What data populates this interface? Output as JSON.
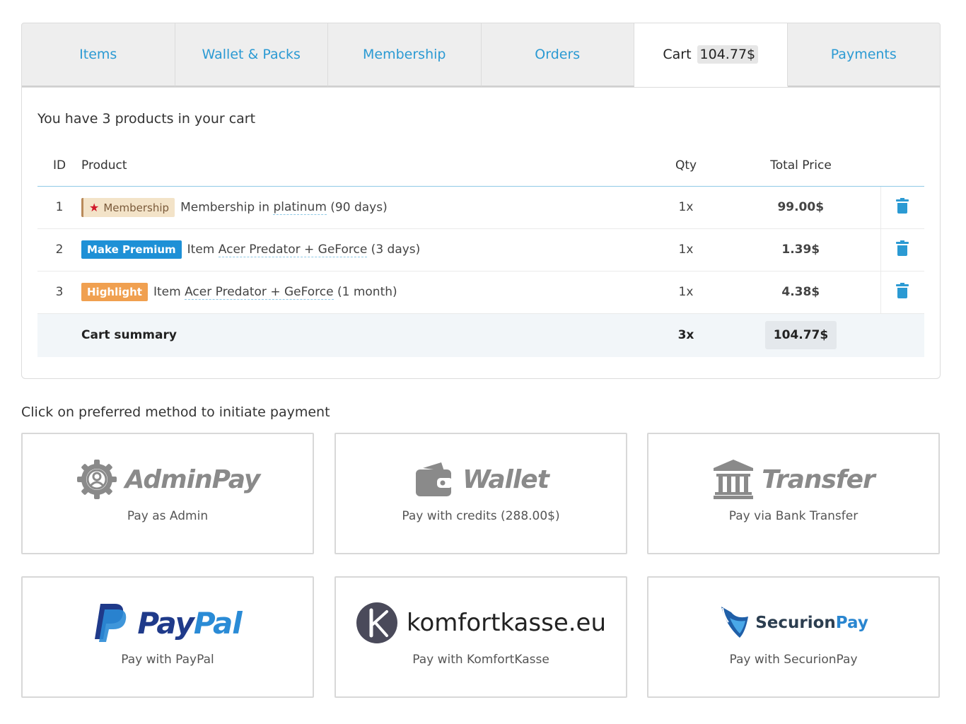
{
  "tabs": [
    {
      "label": "Items"
    },
    {
      "label": "Wallet & Packs"
    },
    {
      "label": "Membership"
    },
    {
      "label": "Orders"
    },
    {
      "label": "Cart",
      "amount": "104.77$",
      "active": true
    },
    {
      "label": "Payments"
    }
  ],
  "cart": {
    "heading": "You have 3 products in your cart",
    "columns": {
      "id": "ID",
      "product": "Product",
      "qty": "Qty",
      "total": "Total Price"
    },
    "rows": [
      {
        "id": "1",
        "badge": "Membership",
        "badge_type": "membership",
        "name_prefix": "Membership in ",
        "name_link": "platinum",
        "name_suffix": " (90 days)",
        "qty": "1x",
        "price": "99.00$"
      },
      {
        "id": "2",
        "badge": "Make Premium",
        "badge_type": "premium",
        "name_prefix": "Item ",
        "name_link": "Acer Predator + GeForce",
        "name_suffix": " (3 days)",
        "qty": "1x",
        "price": "1.39$"
      },
      {
        "id": "3",
        "badge": "Highlight",
        "badge_type": "highlight",
        "name_prefix": "Item ",
        "name_link": "Acer Predator + GeForce",
        "name_suffix": " (1 month)",
        "qty": "1x",
        "price": "4.38$"
      }
    ],
    "summary": {
      "label": "Cart summary",
      "qty": "3x",
      "total": "104.77$"
    }
  },
  "payment": {
    "heading": "Click on preferred method to initiate payment",
    "methods": [
      {
        "logo_text": "AdminPay",
        "icon": "gear-user-icon",
        "caption": "Pay as Admin"
      },
      {
        "logo_text": "Wallet",
        "icon": "wallet-icon",
        "caption": "Pay with credits (288.00$)"
      },
      {
        "logo_text": "Transfer",
        "icon": "bank-icon",
        "caption": "Pay via Bank Transfer"
      },
      {
        "logo_text_a": "Pay",
        "logo_text_b": "Pal",
        "icon": "paypal-icon",
        "caption": "Pay with PayPal"
      },
      {
        "logo_text": "komfortkasse.eu",
        "icon": "komfortkasse-icon",
        "caption": "Pay with KomfortKasse"
      },
      {
        "logo_text_a": "Securion",
        "logo_text_b": "Pay",
        "icon": "securionpay-shield-icon",
        "caption": "Pay with SecurionPay"
      }
    ]
  },
  "colors": {
    "accent": "#2b9ad3",
    "premium": "#1e90d6",
    "highlight": "#f0a050",
    "membership_star": "#d0182a"
  }
}
